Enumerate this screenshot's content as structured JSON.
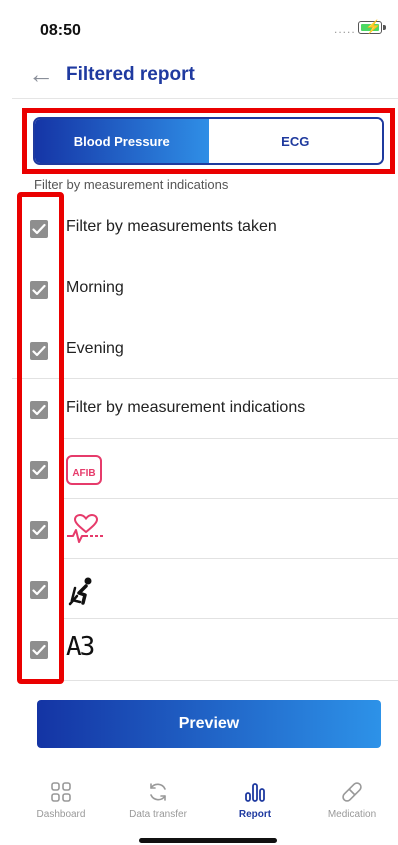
{
  "status_bar": {
    "time": "08:50",
    "signal": "....."
  },
  "header": {
    "back_icon": "arrow-left-icon",
    "title": "Filtered report"
  },
  "segments": [
    {
      "label": "Blood Pressure",
      "active": true
    },
    {
      "label": "ECG",
      "active": false
    }
  ],
  "filter_caption": "Filter by measurement indications",
  "filters": [
    {
      "label": "Filter by measurements taken",
      "checked": true
    },
    {
      "label": "Morning",
      "checked": true
    },
    {
      "label": "Evening",
      "checked": true
    },
    {
      "label": "Filter by measurement indications",
      "checked": true
    },
    {
      "icon": "afib-icon",
      "icon_text": "AFIB",
      "checked": true
    },
    {
      "icon": "irregular-heartbeat-icon",
      "checked": true
    },
    {
      "icon": "posture-icon",
      "checked": true
    },
    {
      "icon": "a3-display-icon",
      "icon_text": "A3",
      "checked": true
    }
  ],
  "preview_button": "Preview",
  "tabs": [
    {
      "label": "Dashboard",
      "icon": "dashboard-icon",
      "active": false
    },
    {
      "label": "Data transfer",
      "icon": "sync-icon",
      "active": false
    },
    {
      "label": "Report",
      "icon": "report-icon",
      "active": true
    },
    {
      "label": "Medication",
      "icon": "pill-icon",
      "active": false
    }
  ],
  "colors": {
    "primary": "#1f3aa0",
    "gradient_start": "#1434a4",
    "gradient_end": "#2d92e8",
    "highlight": "#ea0000",
    "afib": "#e63b6b"
  }
}
